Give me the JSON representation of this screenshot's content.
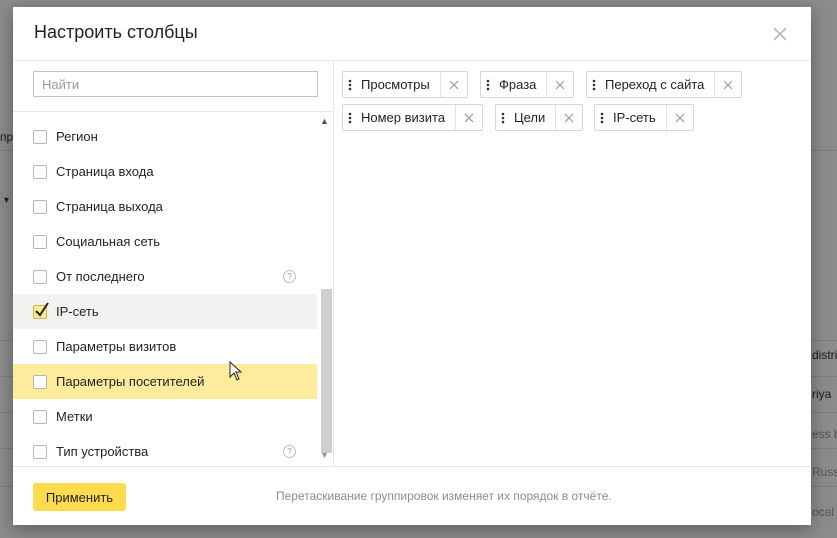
{
  "modal": {
    "title": "Настроить столбцы",
    "search_placeholder": "Найти",
    "apply_label": "Применить",
    "footer_hint": "Перетаскивание группировок изменяет их порядок в отчёте.",
    "close_icon": "close-icon"
  },
  "list_items": [
    {
      "label": "Регион",
      "checked": false,
      "help": false
    },
    {
      "label": "Страница входа",
      "checked": false,
      "help": false
    },
    {
      "label": "Страница выхода",
      "checked": false,
      "help": false
    },
    {
      "label": "Социальная сеть",
      "checked": false,
      "help": false
    },
    {
      "label": "От последнего",
      "checked": false,
      "help": true
    },
    {
      "label": "IP-сеть",
      "checked": true,
      "help": false
    },
    {
      "label": "Параметры визитов",
      "checked": false,
      "help": false
    },
    {
      "label": "Параметры посетителей",
      "checked": false,
      "help": false,
      "hovered": true
    },
    {
      "label": "Метки",
      "checked": false,
      "help": false
    },
    {
      "label": "Тип устройства",
      "checked": false,
      "help": true
    }
  ],
  "help_glyph": "?",
  "scroll": {
    "up_glyph": "▲",
    "down_glyph": "▼"
  },
  "chips": [
    {
      "label": "Просмотры"
    },
    {
      "label": "Фраза"
    },
    {
      "label": "Переход с сайта"
    },
    {
      "label": "Номер визита"
    },
    {
      "label": "Цели"
    },
    {
      "label": "IP-сеть"
    }
  ],
  "background": {
    "texts": [
      "пр",
      "▾",
      "distri",
      "riya",
      "ess b",
      "Russ",
      "ocal"
    ]
  },
  "colors": {
    "accent": "#ffdb4d",
    "hover_row": "#ffeb9c",
    "selected_row": "#f3f2f0",
    "checkbox_checked": "#fde98e"
  }
}
